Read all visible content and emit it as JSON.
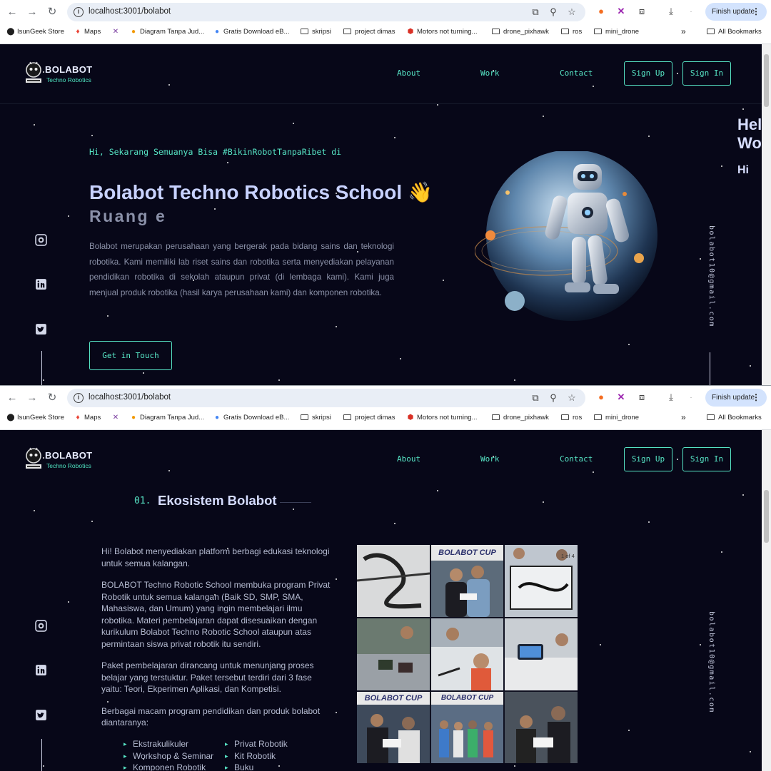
{
  "browser": {
    "url": "localhost:3001/bolabot",
    "finish_update": "Finish update",
    "bookmarks": [
      {
        "label": "IsunGeek Store"
      },
      {
        "label": "Maps"
      },
      {
        "label": "Diagram Tanpa Jud..."
      },
      {
        "label": "Gratis Download eB..."
      },
      {
        "label": "skripsi"
      },
      {
        "label": "project dimas"
      },
      {
        "label": "Motors not turning..."
      },
      {
        "label": "drone_pixhawk"
      },
      {
        "label": "ros"
      },
      {
        "label": "mini_drone"
      }
    ],
    "overflow": "»",
    "all_bookmarks": "All Bookmarks"
  },
  "header": {
    "logo_title": "BOLABOT",
    "logo_subtitle": "Techno Robotics",
    "nav": [
      "About",
      "Work",
      "Contact"
    ],
    "signup": "Sign Up",
    "signin": "Sign In"
  },
  "side": {
    "email": "bolabot10@gmail.com",
    "socials": [
      "github-icon",
      "linkedin-icon",
      "twitter-icon"
    ]
  },
  "hero": {
    "greeting": "Hi, Sekarang Semuanya Bisa #BikinRobotTanpaRibet di",
    "title": "Bolabot Techno Robotics School",
    "wave": "👋",
    "typed": "Ruang e",
    "description": "Bolabot merupakan perusahaan yang bergerak pada bidang sains dan teknologi robotika. Kami memiliki lab riset sains dan robotika serta menyediakan pelayanan pendidikan robotika di sekolah ataupun privat (di lembaga kami). Kami juga menjual produk robotika (hasil karya perusahaan kami) dan komponen robotika.",
    "cta": "Get in Touch",
    "peek_lines": [
      "Hel",
      "Wo",
      "Hi"
    ]
  },
  "section": {
    "number": "01.",
    "title": "Ekosistem Bolabot",
    "paragraphs": [
      "Hi! Bolabot menyediakan platform berbagi edukasi teknologi untuk semua kalangan.",
      "BOLABOT Techno Robotic School membuka program Privat Robotik untuk semua kalangan (Baik SD, SMP, SMA, Mahasiswa, dan Umum) yang ingin membelajari ilmu robotika. Materi pembelajaran dapat disesuaikan dengan kurikulum Bolabot Techno Robotic School ataupun atas permintaan siswa privat robotik itu sendiri.",
      "Paket pembelajaran dirancang untuk menunjang proses belajar yang terstuktur. Paket tersebut terdiri dari 3 fase yaitu: Teori, Ekperimen Aplikasi, dan Kompetisi.",
      "Berbagai macam program pendidikan dan produk bolabot diantaranya:"
    ],
    "programs_left": [
      "Ekstrakulikuler",
      "Workshop & Seminar",
      "Komponen Robotik"
    ],
    "programs_right": [
      "Privat Robotik",
      "Kit Robotik",
      "Buku"
    ],
    "gallery_counter": "1 of 4",
    "banner_text": "BOLABOT CUP"
  },
  "colors": {
    "background": "#070718",
    "accent": "#57e5c6",
    "title": "#c8d2ff",
    "text": "#8b91a8"
  }
}
